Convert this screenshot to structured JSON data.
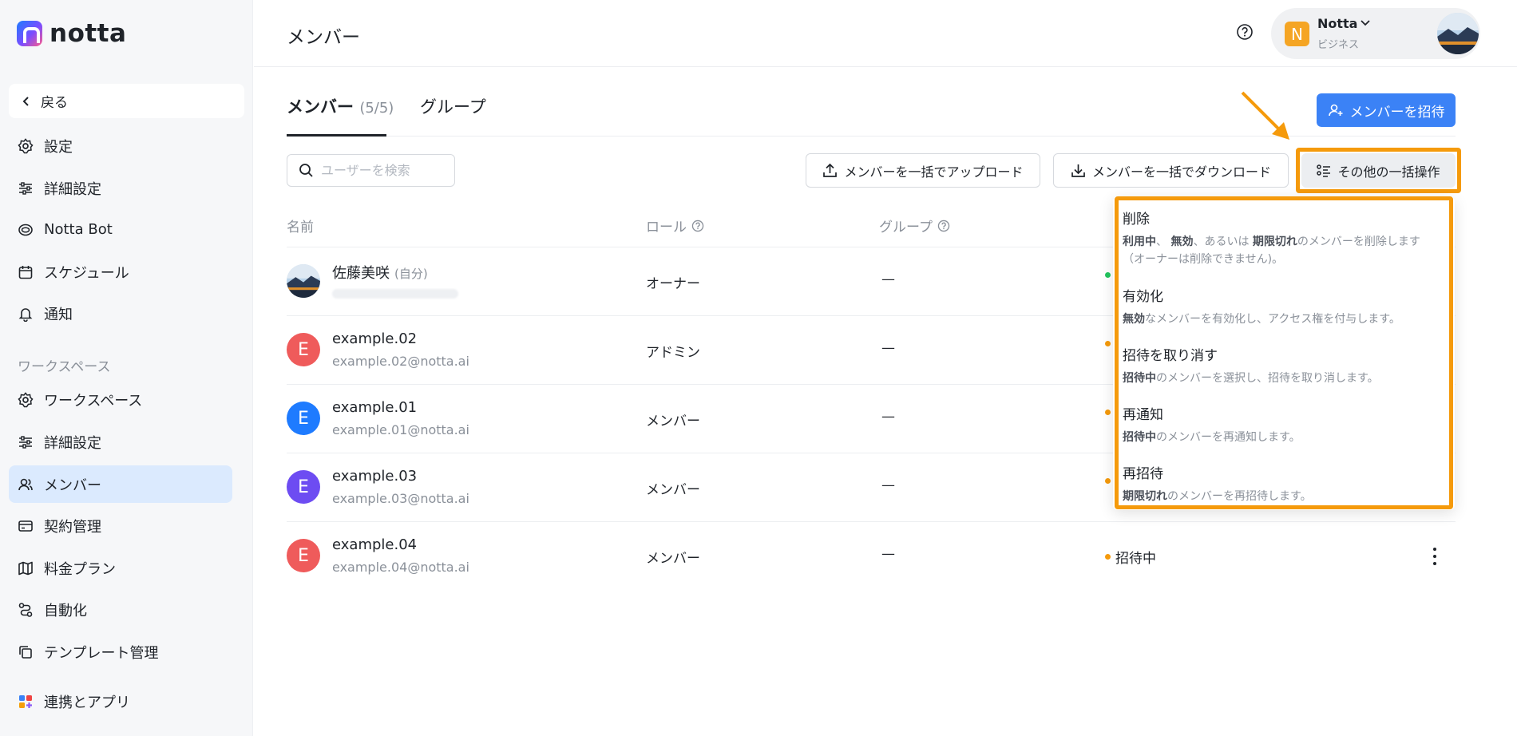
{
  "brand": {
    "name": "notta"
  },
  "sidebar": {
    "back_label": "戻る",
    "items": [
      {
        "label": "設定",
        "icon": "gear-icon"
      },
      {
        "label": "詳細設定",
        "icon": "sliders-icon"
      },
      {
        "label": "Notta Bot",
        "icon": "bot-icon"
      },
      {
        "label": "スケジュール",
        "icon": "calendar-icon"
      },
      {
        "label": "通知",
        "icon": "bell-icon"
      }
    ],
    "workspace_section": "ワークスペース",
    "workspace_items": [
      {
        "label": "ワークスペース",
        "icon": "gear-icon"
      },
      {
        "label": "詳細設定",
        "icon": "sliders-icon"
      },
      {
        "label": "メンバー",
        "icon": "users-icon",
        "active": true
      },
      {
        "label": "契約管理",
        "icon": "card-icon"
      },
      {
        "label": "料金プラン",
        "icon": "map-icon"
      },
      {
        "label": "自動化",
        "icon": "flow-icon"
      },
      {
        "label": "テンプレート管理",
        "icon": "template-icon"
      }
    ],
    "integrations_label": "連携とアプリ"
  },
  "header": {
    "title": "メンバー",
    "account_name": "Notta",
    "account_plan": "ビジネス",
    "account_badge": "N"
  },
  "tabs": {
    "members_label": "メンバー",
    "members_count": "(5/5)",
    "groups_label": "グループ"
  },
  "toolbar": {
    "invite_label": "メンバーを招待",
    "search_placeholder": "ユーザーを検索",
    "upload_label": "メンバーを一括でアップロード",
    "download_label": "メンバーを一括でダウンロード",
    "bulk_label": "その他の一括操作"
  },
  "table": {
    "headers": {
      "name": "名前",
      "role": "ロール",
      "group": "グループ"
    },
    "rows": [
      {
        "name": "佐藤美咲",
        "self": "(自分)",
        "email": "",
        "role": "オーナー",
        "group": "—",
        "status": "",
        "avatar": "photo"
      },
      {
        "name": "example.02",
        "email": "example.02@notta.ai",
        "role": "アドミン",
        "group": "—",
        "status": "",
        "avatar": "E"
      },
      {
        "name": "example.01",
        "email": "example.01@notta.ai",
        "role": "メンバー",
        "group": "—",
        "status": "",
        "avatar": "E"
      },
      {
        "name": "example.03",
        "email": "example.03@notta.ai",
        "role": "メンバー",
        "group": "—",
        "status": "",
        "avatar": "E"
      },
      {
        "name": "example.04",
        "email": "example.04@notta.ai",
        "role": "メンバー",
        "group": "—",
        "status": "招待中",
        "avatar": "E"
      }
    ]
  },
  "dropdown": {
    "items": [
      {
        "title": "削除",
        "desc_bold1": "利用中",
        "desc_sep1": "、 ",
        "desc_bold2": "無効",
        "desc_sep2": "、あるいは ",
        "desc_bold3": "期限切れ",
        "desc_rest": "のメンバーを削除します（オーナーは削除できません)。"
      },
      {
        "title": "有効化",
        "desc_bold": "無効",
        "desc_rest": "なメンバーを有効化し、アクセス権を付与します。"
      },
      {
        "title": "招待を取り消す",
        "desc_bold": "招待中",
        "desc_rest": "のメンバーを選択し、招待を取り消します。"
      },
      {
        "title": "再通知",
        "desc_bold": "招待中",
        "desc_rest": "のメンバーを再通知します。"
      },
      {
        "title": "再招待",
        "desc_bold": "期限切れ",
        "desc_rest": "のメンバーを再招待します。"
      }
    ]
  },
  "colors": {
    "accent": "#3b82f6",
    "highlight": "#f59a0b",
    "avatar_red": "#ef5b5b",
    "avatar_blue": "#1e7bff",
    "avatar_purple": "#6d4cf2",
    "status_green": "#22c55e",
    "status_orange": "#f59a0b"
  }
}
